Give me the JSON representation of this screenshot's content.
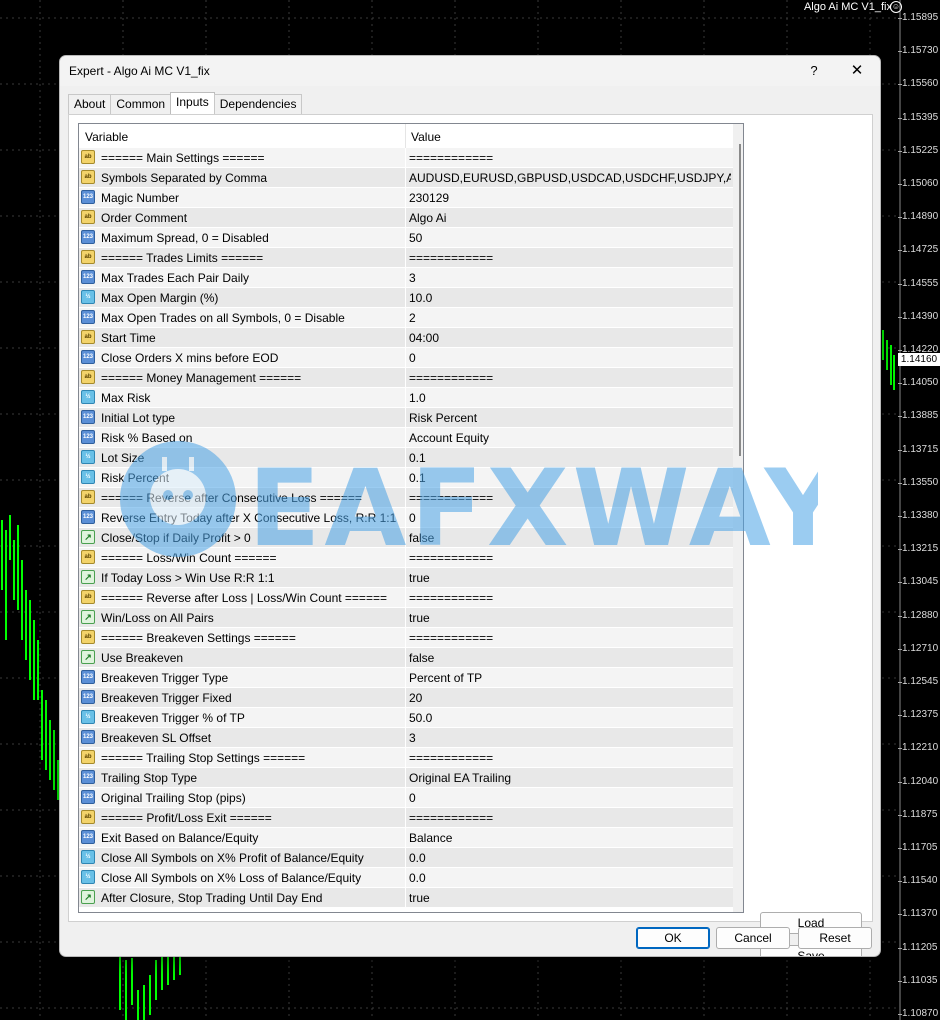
{
  "chart": {
    "title": "Algo Ai MC V1_fix",
    "current_price": "1.14160",
    "price_labels": [
      "1.15895",
      "1.15730",
      "1.15560",
      "1.15395",
      "1.15225",
      "1.15060",
      "1.14890",
      "1.14725",
      "1.14555",
      "1.14390",
      "1.14220",
      "1.14050",
      "1.13885",
      "1.13715",
      "1.13550",
      "1.13380",
      "1.13215",
      "1.13045",
      "1.12880",
      "1.12710",
      "1.12545",
      "1.12375",
      "1.12210",
      "1.12040",
      "1.11875",
      "1.11705",
      "1.11540",
      "1.11370",
      "1.11205",
      "1.11035",
      "1.10870"
    ],
    "colors": {
      "bull": "#00ff00",
      "grid": "#3a3a3a",
      "background": "#000000"
    }
  },
  "dialog": {
    "title": "Expert - Algo Ai MC V1_fix",
    "help_label": "?",
    "close_label": "✕",
    "tabs": [
      "About",
      "Common",
      "Inputs",
      "Dependencies"
    ],
    "active_tab": "Inputs",
    "columns": {
      "variable": "Variable",
      "value": "Value"
    },
    "rows": [
      {
        "icon": "ab",
        "variable": "====== Main Settings ======",
        "value": "============"
      },
      {
        "icon": "ab",
        "variable": "Symbols Separated by Comma",
        "value": "AUDUSD,EURUSD,GBPUSD,USDCAD,USDCHF,USDJPY,AUD..."
      },
      {
        "icon": "123",
        "variable": "Magic Number",
        "value": "230129"
      },
      {
        "icon": "ab",
        "variable": "Order Comment",
        "value": "Algo Ai"
      },
      {
        "icon": "123",
        "variable": "Maximum Spread, 0 = Disabled",
        "value": "50"
      },
      {
        "icon": "ab",
        "variable": "====== Trades Limits ======",
        "value": "============"
      },
      {
        "icon": "123",
        "variable": "Max Trades Each Pair Daily",
        "value": "3"
      },
      {
        "icon": "1/2",
        "variable": "Max Open Margin (%)",
        "value": "10.0"
      },
      {
        "icon": "123",
        "variable": "Max Open Trades on all Symbols, 0 = Disable",
        "value": "2"
      },
      {
        "icon": "ab",
        "variable": "Start Time",
        "value": "04:00"
      },
      {
        "icon": "123",
        "variable": "Close Orders X mins before EOD",
        "value": "0"
      },
      {
        "icon": "ab",
        "variable": "====== Money Management ======",
        "value": "============"
      },
      {
        "icon": "1/2",
        "variable": "Max Risk",
        "value": "1.0"
      },
      {
        "icon": "123",
        "variable": "Initial Lot type",
        "value": "Risk Percent"
      },
      {
        "icon": "123",
        "variable": "Risk % Based on",
        "value": "Account Equity"
      },
      {
        "icon": "1/2",
        "variable": "Lot Size",
        "value": "0.1"
      },
      {
        "icon": "1/2",
        "variable": "Risk Percent",
        "value": "0.1"
      },
      {
        "icon": "ab",
        "variable": "====== Reverse after Consecutive Loss ======",
        "value": "============"
      },
      {
        "icon": "123",
        "variable": "Reverse Entry Today after X Consecutive Loss, R:R 1:1",
        "value": "0"
      },
      {
        "icon": "bool",
        "variable": "Close/Stop if Daily Profit > 0",
        "value": "false"
      },
      {
        "icon": "ab",
        "variable": "====== Loss/Win Count ======",
        "value": "============"
      },
      {
        "icon": "bool",
        "variable": "If Today Loss > Win Use R:R 1:1",
        "value": "true"
      },
      {
        "icon": "ab",
        "variable": "====== Reverse after Loss | Loss/Win Count ======",
        "value": "============"
      },
      {
        "icon": "bool",
        "variable": "Win/Loss on All Pairs",
        "value": "true"
      },
      {
        "icon": "ab",
        "variable": "====== Breakeven Settings ======",
        "value": "============"
      },
      {
        "icon": "bool",
        "variable": "Use Breakeven",
        "value": "false"
      },
      {
        "icon": "123",
        "variable": "Breakeven Trigger Type",
        "value": "Percent of TP"
      },
      {
        "icon": "123",
        "variable": "Breakeven Trigger Fixed",
        "value": "20"
      },
      {
        "icon": "1/2",
        "variable": "Breakeven Trigger % of TP",
        "value": "50.0"
      },
      {
        "icon": "123",
        "variable": "Breakeven SL Offset",
        "value": "3"
      },
      {
        "icon": "ab",
        "variable": "====== Trailing Stop Settings ======",
        "value": "============"
      },
      {
        "icon": "123",
        "variable": "Trailing Stop Type",
        "value": "Original EA Trailing"
      },
      {
        "icon": "123",
        "variable": "Original Trailing Stop (pips)",
        "value": "0"
      },
      {
        "icon": "ab",
        "variable": "====== Profit/Loss Exit ======",
        "value": "============"
      },
      {
        "icon": "123",
        "variable": "Exit Based on Balance/Equity",
        "value": "Balance"
      },
      {
        "icon": "1/2",
        "variable": "Close All Symbols on X% Profit of Balance/Equity",
        "value": "0.0"
      },
      {
        "icon": "1/2",
        "variable": "Close All Symbols on X% Loss of Balance/Equity",
        "value": "0.0"
      },
      {
        "icon": "bool",
        "variable": "After Closure, Stop Trading Until Day End",
        "value": "true"
      }
    ],
    "buttons": {
      "load": "Load",
      "save": "Save",
      "ok": "OK",
      "cancel": "Cancel",
      "reset": "Reset"
    }
  },
  "watermark": {
    "text": "EAFXWAY"
  }
}
